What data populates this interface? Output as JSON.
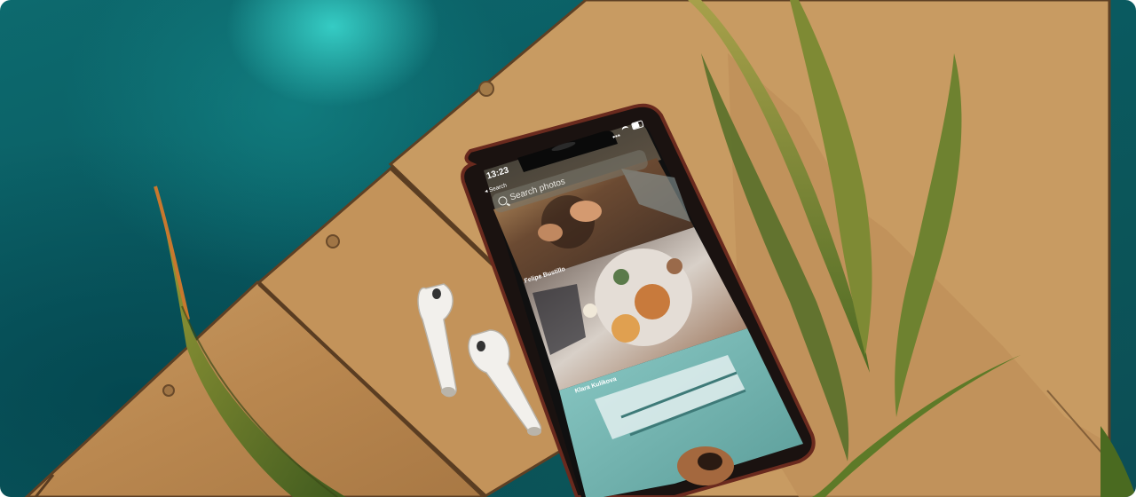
{
  "phone": {
    "status_time": "13:23",
    "back_label": "◂ Search",
    "search_placeholder": "Search photos",
    "photo_credits": [
      "Felipe Bustillo",
      "Klara Kulikova"
    ]
  }
}
